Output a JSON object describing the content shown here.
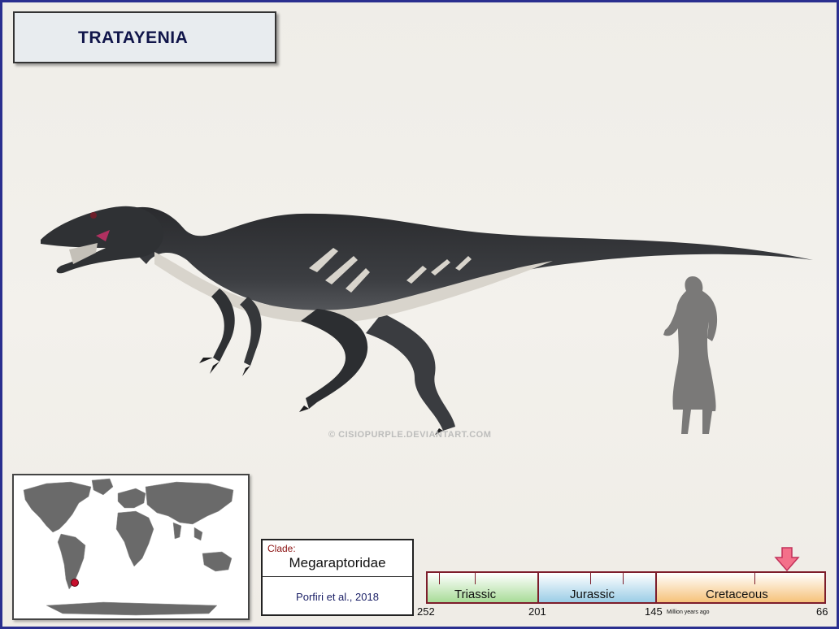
{
  "title": "TRATAYENIA",
  "watermark": "© CISIOPURPLE.DEVIANTART.COM",
  "clade": {
    "label": "Clade:",
    "name": "Megaraptoridae",
    "citation": "Porfiri et al., 2018"
  },
  "timeline": {
    "periods": [
      {
        "name": "Triassic",
        "color": "#a8dc98"
      },
      {
        "name": "Jurassic",
        "color": "#9bcde6"
      },
      {
        "name": "Cretaceous",
        "color": "#f6c27a"
      }
    ],
    "ticks": [
      "252",
      "201",
      "145",
      "66"
    ],
    "unit": "Million years ago",
    "marker_ma": 75
  },
  "colors": {
    "frame": "#2a2f8f",
    "title_text": "#10154a",
    "clade_label": "#8b1010",
    "timeline_border": "#7d1d2b",
    "marker": "#f4708a",
    "location_dot": "#c8102e"
  },
  "icons": {
    "marker": "down-arrow-icon",
    "location": "location-dot-icon"
  }
}
